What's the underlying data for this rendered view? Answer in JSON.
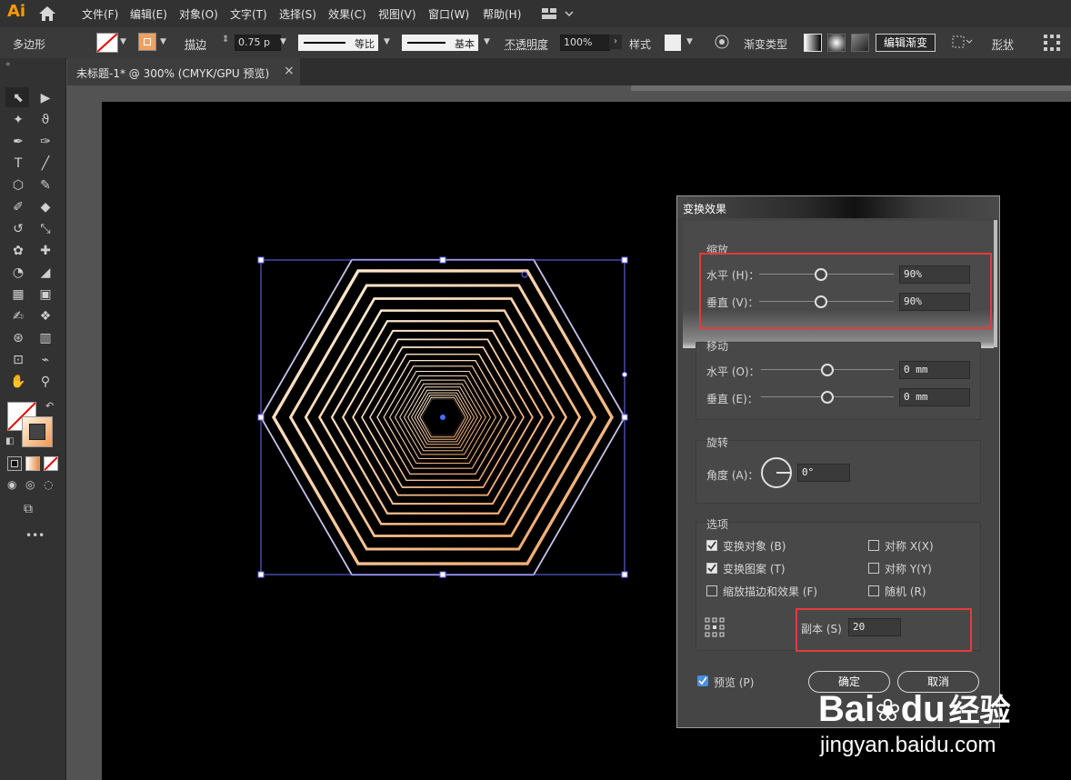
{
  "app": {
    "logo": "Ai"
  },
  "menu": [
    "文件(F)",
    "编辑(E)",
    "对象(O)",
    "文字(T)",
    "选择(S)",
    "效果(C)",
    "视图(V)",
    "窗口(W)",
    "帮助(H)"
  ],
  "control_bar": {
    "shape_name": "多边形",
    "stroke_label": "描边",
    "stroke_value": "0.75 p",
    "stroke_profile": "等比",
    "brush": "基本",
    "opacity_label": "不透明度",
    "opacity_value": "100%",
    "style_label": "样式",
    "gradient_type_label": "渐变类型",
    "edit_gradient_button": "编辑渐变",
    "shape_label": "形状"
  },
  "tab": {
    "title": "未标题-1* @ 300% (CMYK/GPU 预览)",
    "close": "×"
  },
  "toolbar": {
    "more": "•••"
  },
  "dialog": {
    "title": "变换效果",
    "scale": {
      "label": "缩放",
      "horizontal_label": "水平 (H)：",
      "horizontal_value": "90%",
      "vertical_label": "垂直 (V)：",
      "vertical_value": "90%"
    },
    "move": {
      "label": "移动",
      "horizontal_label": "水平 (O)：",
      "horizontal_value": "0 mm",
      "vertical_label": "垂直 (E)：",
      "vertical_value": "0 mm"
    },
    "rotate": {
      "label": "旋转",
      "angle_label": "角度 (A)：",
      "angle_value": "0°"
    },
    "options": {
      "label": "选项",
      "transform_objects": "变换对象 (B)",
      "transform_patterns": "变换图案 (T)",
      "scale_strokes": "缩放描边和效果 (F)",
      "reflect_x": "对称 X(X)",
      "reflect_y": "对称 Y(Y)",
      "random": "随机 (R)"
    },
    "copies_label": "副本 (S)",
    "copies_value": "20",
    "preview_label": "预览 (P)",
    "ok_button": "确定",
    "cancel_button": "取消"
  },
  "watermark": {
    "brand": "Bai",
    "brand2": "du",
    "suffix": "经验",
    "url": "jingyan.baidu.com"
  },
  "colors": {
    "accent": "#ff9a00",
    "gradient_light": "#fff1dc",
    "gradient_dark": "#f0a464",
    "selection": "#6b6bff",
    "highlight": "#e23b3b"
  }
}
